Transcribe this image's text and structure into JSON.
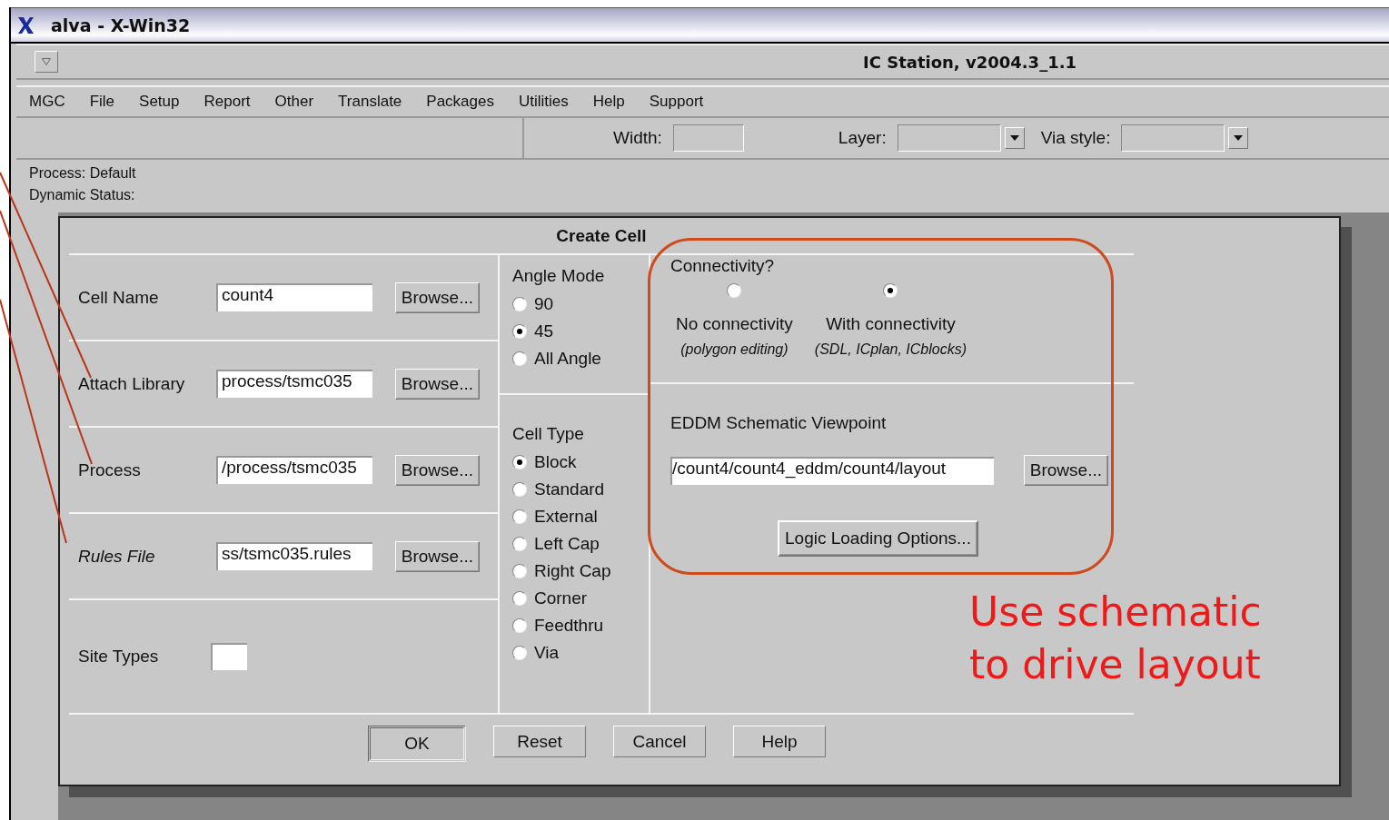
{
  "window": {
    "title": "alva - X-Win32"
  },
  "app": {
    "title": "IC Station, v2004.3_1.1"
  },
  "menu": [
    "MGC",
    "File",
    "Setup",
    "Report",
    "Other",
    "Translate",
    "Packages",
    "Utilities",
    "Help",
    "Support"
  ],
  "toolbar": [
    {
      "kind": "text",
      "label": "Width:"
    },
    {
      "kind": "dropdown",
      "label": "Layer:"
    },
    {
      "kind": "dropdown",
      "label": "Via style:"
    }
  ],
  "status": [
    "Process: Default",
    "Dynamic Status:"
  ],
  "dialog": {
    "title": "Create Cell",
    "fields": [
      {
        "kind": "browse",
        "label": "Cell Name",
        "value": "count4",
        "italic": false,
        "button": "Browse..."
      },
      {
        "kind": "browse",
        "label": "Attach Library",
        "value": "process/tsmc035",
        "italic": false,
        "button": "Browse..."
      },
      {
        "kind": "browse",
        "label": "Process",
        "value": "/process/tsmc035",
        "italic": false,
        "button": "Browse..."
      },
      {
        "kind": "browse",
        "label": "Rules File",
        "value": "ss/tsmc035.rules",
        "italic": true,
        "button": "Browse..."
      },
      {
        "kind": "small",
        "label": "Site Types",
        "italic": false
      }
    ],
    "angle_mode": {
      "title": "Angle Mode",
      "options": [
        {
          "label": "90",
          "selected": false
        },
        {
          "label": "45",
          "selected": true
        },
        {
          "label": "All Angle",
          "selected": false
        }
      ]
    },
    "cell_type": {
      "title": "Cell Type",
      "options": [
        {
          "label": "Block",
          "selected": true
        },
        {
          "label": "Standard",
          "selected": false
        },
        {
          "label": "External",
          "selected": false
        },
        {
          "label": "Left Cap",
          "selected": false
        },
        {
          "label": "Right Cap",
          "selected": false
        },
        {
          "label": "Corner",
          "selected": false
        },
        {
          "label": "Feedthru",
          "selected": false
        },
        {
          "label": "Via",
          "selected": false
        }
      ]
    },
    "connectivity": {
      "title": "Connectivity?",
      "options": [
        {
          "label": "No connectivity",
          "note": "(polygon editing)",
          "selected": false
        },
        {
          "label": "With connectivity",
          "note": "(SDL, ICplan, ICblocks)",
          "selected": true
        }
      ]
    },
    "viewpoint": {
      "title": "EDDM Schematic Viewpoint",
      "value": "/count4/count4_eddm/count4/layout",
      "button": "Browse..."
    },
    "logic_button": "Logic Loading Options...",
    "buttons": [
      {
        "label": "OK",
        "default": true
      },
      {
        "label": "Reset",
        "default": false
      },
      {
        "label": "Cancel",
        "default": false
      },
      {
        "label": "Help",
        "default": false
      }
    ]
  },
  "annotation": {
    "text": "Use schematic\nto drive layout"
  }
}
